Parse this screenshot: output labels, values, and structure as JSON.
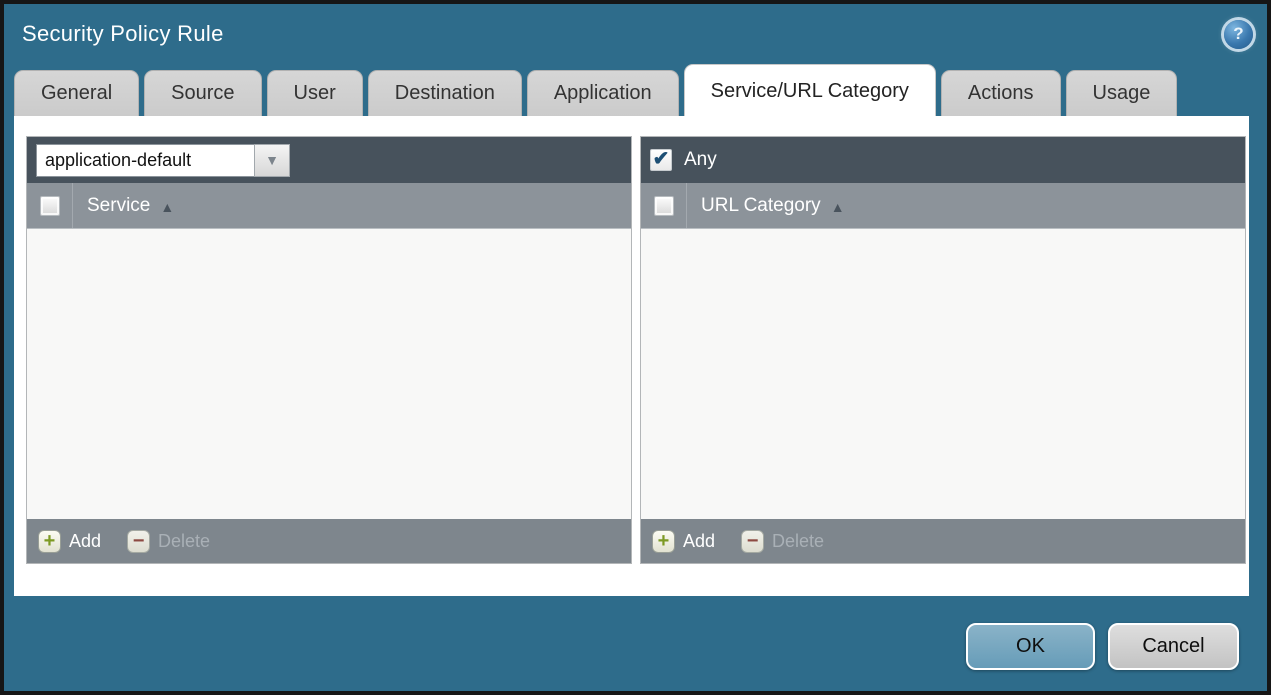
{
  "titlebar": {
    "title": "Security Policy Rule"
  },
  "icons": {
    "help": "?",
    "check": "✔",
    "sort_asc": "▲",
    "dropdown_arrow": "▼",
    "plus": "+",
    "minus": "−"
  },
  "tabs": [
    {
      "label": "General",
      "active": false
    },
    {
      "label": "Source",
      "active": false
    },
    {
      "label": "User",
      "active": false
    },
    {
      "label": "Destination",
      "active": false
    },
    {
      "label": "Application",
      "active": false
    },
    {
      "label": "Service/URL Category",
      "active": true
    },
    {
      "label": "Actions",
      "active": false
    },
    {
      "label": "Usage",
      "active": false
    }
  ],
  "service_panel": {
    "dropdown": {
      "value": "application-default"
    },
    "column_header": "Service",
    "sort": "asc",
    "rows": [],
    "footer": {
      "add_label": "Add",
      "delete_label": "Delete",
      "delete_enabled": false
    }
  },
  "url_panel": {
    "any_checkbox": {
      "label": "Any",
      "checked": true
    },
    "column_header": "URL Category",
    "sort": "asc",
    "rows": [],
    "footer": {
      "add_label": "Add",
      "delete_label": "Delete",
      "delete_enabled": false
    }
  },
  "dialog_buttons": {
    "ok": "OK",
    "cancel": "Cancel"
  },
  "colors": {
    "window_bg": "#2e6c8b",
    "panel_topbar": "#47525c",
    "panel_header": "#8c939a",
    "panel_footer": "#7e868d",
    "ok_button": "#6fa2bc",
    "cancel_button": "#cccccc",
    "add_plus": "#7d9a24",
    "delete_minus": "#8d4a42"
  }
}
